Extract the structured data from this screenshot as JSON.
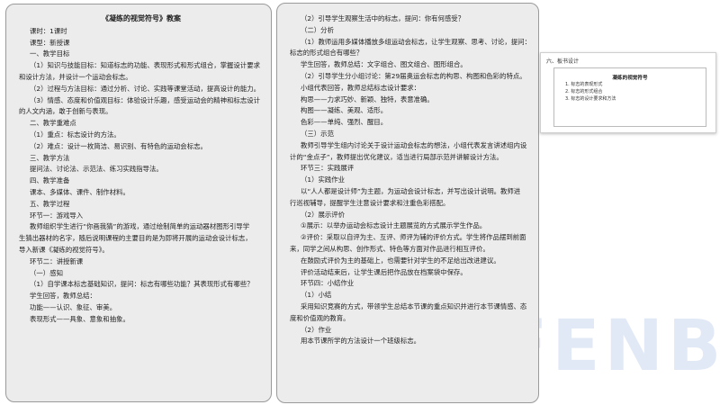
{
  "left_page": {
    "lines": [
      {
        "text": "《凝练的视觉符号》教案",
        "style": "title"
      },
      {
        "text": "课时：1课时",
        "style": "ind"
      },
      {
        "text": "课型：新授课",
        "style": "ind"
      },
      {
        "text": "一、教学目标",
        "style": "ind"
      },
      {
        "text": "（1）知识与技能目标：知道标志的功能、表现形式和形式组合，掌握设计要求",
        "style": "ind"
      },
      {
        "text": "和设计方法，并设计一个运动会标志。",
        "style": ""
      },
      {
        "text": "（2）过程与方法目标：通过分析、讨论、实践等课堂活动，提高设计的能力。",
        "style": "ind"
      },
      {
        "text": "（3）情感、态度和价值观目标：体验设计乐趣，感受运动会的精神和标志设计",
        "style": "ind"
      },
      {
        "text": "的人文内涵，敢于创新与表现。",
        "style": ""
      },
      {
        "text": "二、教学重难点",
        "style": "ind"
      },
      {
        "text": "（1）重点：标志设计的方法。",
        "style": "ind"
      },
      {
        "text": "（2）难点：设计一枚简洁、易识别、有特色的运动会标志。",
        "style": "ind"
      },
      {
        "text": "三、教学方法",
        "style": "ind"
      },
      {
        "text": "提问法、讨论法、示范法、练习实践指导法。",
        "style": "ind"
      },
      {
        "text": "四、教学准备",
        "style": "ind"
      },
      {
        "text": "课本、多媒体、课件、制作材料。",
        "style": "ind"
      },
      {
        "text": "五、教学过程",
        "style": "ind"
      },
      {
        "text": "环节一：游戏导入",
        "style": "ind"
      },
      {
        "text": "教师组织学生进行“你画我猜”的游戏，通过绘制简单的运动器材图形引导学",
        "style": "ind"
      },
      {
        "text": "生猜出器材的名字，随后说明课程的主要目的是为即将开展的运动会设计标志，",
        "style": ""
      },
      {
        "text": "导入新课《凝练的视觉符号》。",
        "style": ""
      },
      {
        "text": "环节二：讲授新课",
        "style": "ind"
      },
      {
        "text": "（一）感知",
        "style": "ind"
      },
      {
        "text": "（1）自学课本标志基础知识，提问：标志有哪些功能？其表现形式有哪些？",
        "style": "ind"
      },
      {
        "text": "学生回答，教师总结：",
        "style": "ind"
      },
      {
        "text": "功能——认识、象征、审美。",
        "style": "ind"
      },
      {
        "text": "表现形式——具象、意象和抽象。",
        "style": "ind"
      }
    ]
  },
  "mid_page": {
    "lines": [
      {
        "text": "（2）引导学生观察生活中的标志，提问：你有何感受？",
        "style": "ind"
      },
      {
        "text": "（二）分析",
        "style": "ind"
      },
      {
        "text": "（1）教师运用多媒体播放多组运动会标志，让学生观察、思考、讨论，提问：",
        "style": "ind"
      },
      {
        "text": "标志的形式组合有哪些？",
        "style": ""
      },
      {
        "text": "学生回答，教师总结：文字组合、图文组合、图形组合。",
        "style": "ind"
      },
      {
        "text": "（2）引导学生分小组讨论：第29届奥运会标志的构思、构图和色彩的特点。",
        "style": "ind"
      },
      {
        "text": "小组代表回答，教师总结标志设计要求：",
        "style": "ind"
      },
      {
        "text": "构思——力求巧妙、新颖、独特，表意准确。",
        "style": "ind"
      },
      {
        "text": "构图——凝练、美观、适形。",
        "style": "ind"
      },
      {
        "text": "色彩——单纯、强烈、醒目。",
        "style": "ind"
      },
      {
        "text": "（三）示范",
        "style": "ind"
      },
      {
        "text": "教师引导学生组内讨论关于设计运动会标志的想法，小组代表发言讲述组内设",
        "style": "ind"
      },
      {
        "text": "计的“金点子”，教师提出优化建议，适当进行局部示范并讲解设计方法。",
        "style": ""
      },
      {
        "text": "环节三：实践展评",
        "style": "ind"
      },
      {
        "text": "（1）实践作业",
        "style": "ind"
      },
      {
        "text": "以“人人都是设计师”为主题，为运动会设计标志，并写出设计说明。教师进",
        "style": "ind"
      },
      {
        "text": "行巡视辅导，提醒学生注意设计要求和注重色彩搭配。",
        "style": ""
      },
      {
        "text": "（2）展示评价",
        "style": "ind"
      },
      {
        "text": "①展示：以举办运动会标志设计主题展览的方式展示学生作品。",
        "style": "ind"
      },
      {
        "text": "②评价：采取以自评为主、互评、师评为辅的评价方式。学生将作品摆到前面",
        "style": "ind"
      },
      {
        "text": "来，同学之间从构思、创作形式、特色等方面对作品进行相互评价。",
        "style": ""
      },
      {
        "text": "在鼓励式评价为主的基础上，也需要针对学生的不足给出改进建议。",
        "style": "ind"
      },
      {
        "text": "评价活动结束后，让学生课后把作品放在档案袋中保存。",
        "style": "ind"
      },
      {
        "text": "环节四：小结作业",
        "style": "ind"
      },
      {
        "text": "（1）小结",
        "style": "ind"
      },
      {
        "text": "采用知识竞赛的方式，带领学生总结本节课的重点知识并进行本节课情感、态",
        "style": "ind"
      },
      {
        "text": "度和价值观的教育。",
        "style": ""
      },
      {
        "text": "（2）作业",
        "style": "ind"
      },
      {
        "text": "用本节课所学的方法设计一个班级标志。",
        "style": "ind"
      }
    ]
  },
  "slide": {
    "header": "六、板书设计",
    "title": "凝练的视觉符号",
    "items": [
      "1. 标志的表现形式",
      "2. 标志的形式组合",
      "3. 标志的设计要求和方法"
    ]
  },
  "watermark": "FENBI",
  "colors": {
    "page_bg": "#ececec",
    "border": "#9a9a9a",
    "watermark": "#e2e9f6"
  }
}
